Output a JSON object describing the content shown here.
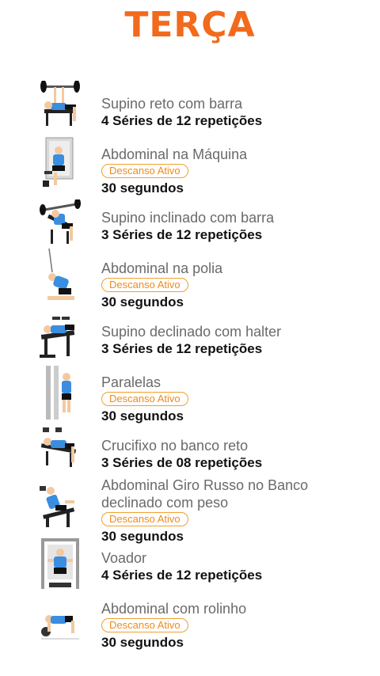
{
  "header": {
    "title": "TERÇA"
  },
  "colors": {
    "accent": "#f26a1b",
    "badge_border": "#f0a030",
    "shirt": "#3a8ee0"
  },
  "exercises": [
    {
      "name": "Supino reto com barra",
      "detail": "4 Séries de 12 repetições",
      "icon": "bench-press-icon"
    },
    {
      "name": "Abdominal na Máquina",
      "badge": "Descanso Ativo",
      "detail": "30 segundos",
      "icon": "ab-machine-icon"
    },
    {
      "name": "Supino inclinado com barra",
      "detail": "3 Séries de 12 repetições",
      "icon": "incline-press-icon"
    },
    {
      "name": "Abdominal na polia",
      "badge": "Descanso Ativo",
      "detail": "30 segundos",
      "icon": "cable-crunch-icon"
    },
    {
      "name": "Supino declinado com halter",
      "detail": "3 Séries de 12 repetições",
      "icon": "decline-press-icon"
    },
    {
      "name": "Paralelas",
      "badge": "Descanso Ativo",
      "detail": "30 segundos",
      "icon": "parallel-bars-icon"
    },
    {
      "name": "Crucifixo no banco reto",
      "detail": "3 Séries de 08 repetições",
      "icon": "dumbbell-fly-icon"
    },
    {
      "name": "Abdominal Giro Russo no Banco declinado com peso",
      "badge": "Descanso Ativo",
      "detail": "30 segundos",
      "icon": "russian-twist-icon"
    },
    {
      "name": "Voador",
      "detail": "4 Séries de 12 repetições",
      "icon": "pec-deck-icon"
    },
    {
      "name": "Abdominal com rolinho",
      "badge": "Descanso Ativo",
      "detail": "30 segundos",
      "icon": "ab-roller-icon"
    }
  ]
}
